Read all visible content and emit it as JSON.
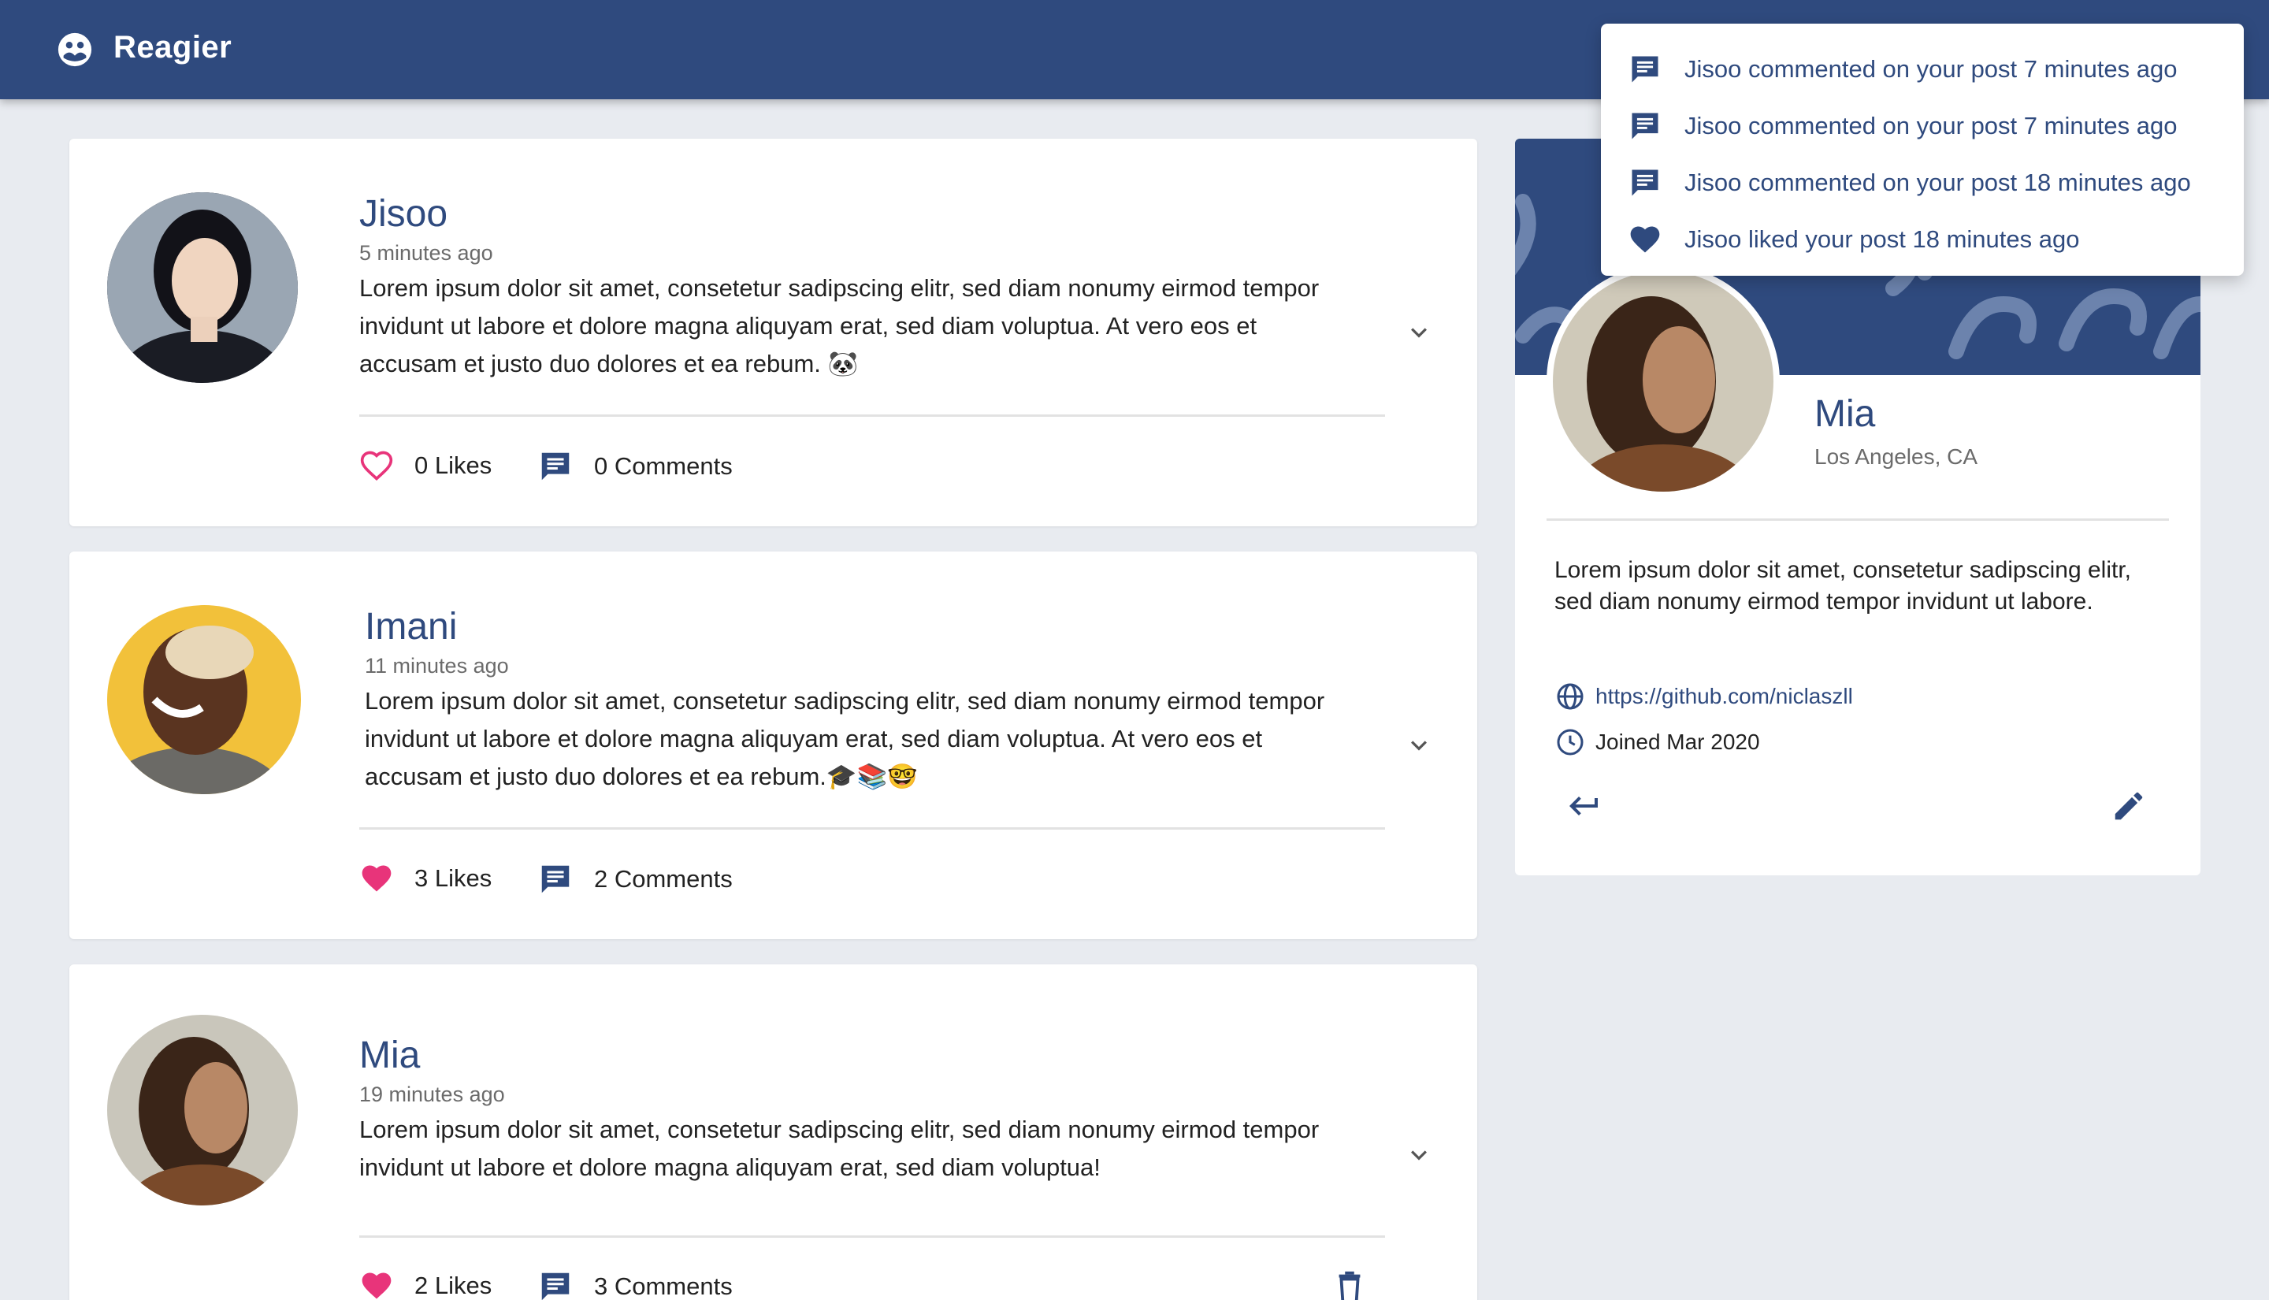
{
  "header": {
    "brand": "Reagier",
    "brand_icon": "globe-people-icon",
    "color": "#2f4a7e"
  },
  "posts": [
    {
      "author": "Jisoo",
      "time": "5 minutes ago",
      "body": "Lorem ipsum dolor sit amet, consetetur sadipscing elitr, sed diam nonumy eirmod tempor invidunt ut labore et dolore magna aliquyam erat, sed diam voluptua. At vero eos et accusam et justo duo dolores et ea rebum. 🐼",
      "likes": "0 Likes",
      "comments": "0 Comments",
      "liked": false
    },
    {
      "author": "Imani",
      "time": "11 minutes ago",
      "body": "Lorem ipsum dolor sit amet, consetetur sadipscing elitr, sed diam nonumy eirmod tempor invidunt ut labore et dolore magna aliquyam erat, sed diam voluptua. At vero eos et accusam et justo duo dolores et ea rebum.🎓📚🤓",
      "likes": "3 Likes",
      "comments": "2 Comments",
      "liked": true
    },
    {
      "author": "Mia",
      "time": "19 minutes ago",
      "body": "Lorem ipsum dolor sit amet, consetetur sadipscing elitr, sed diam nonumy eirmod tempor invidunt ut labore et dolore magna aliquyam erat, sed diam voluptua!",
      "likes": "2 Likes",
      "comments": "3 Comments",
      "liked": true
    }
  ],
  "profile": {
    "name": "Mia",
    "location": "Los Angeles, CA",
    "bio": "Lorem ipsum dolor sit amet, consetetur sadipscing elitr, sed diam nonumy eirmod tempor invidunt ut labore.",
    "website": "https://github.com/niclaszll",
    "joined": "Joined Mar 2020"
  },
  "notifications": [
    {
      "icon": "comment-icon",
      "text": "Jisoo commented on your post 7 minutes ago"
    },
    {
      "icon": "comment-icon",
      "text": "Jisoo commented on your post 7 minutes ago"
    },
    {
      "icon": "comment-icon",
      "text": "Jisoo commented on your post 18 minutes ago"
    },
    {
      "icon": "heart-icon",
      "text": "Jisoo liked your post 18 minutes ago"
    }
  ],
  "colors": {
    "primary": "#2f4a7e",
    "like": "#e8347a",
    "background": "#e8ebf0"
  }
}
